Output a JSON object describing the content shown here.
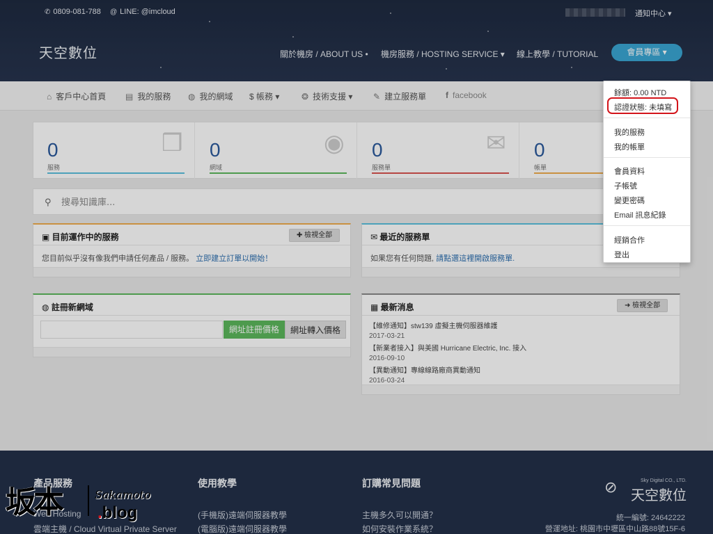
{
  "header": {
    "phone": "0809-081-788",
    "line": "LINE: @imcloud",
    "notify": "通知中心 ▾",
    "logo": "天空數位",
    "nav": [
      {
        "label": "關於機房 / ABOUT US •"
      },
      {
        "label": "機房服務 / HOSTING SERVICE ▾"
      },
      {
        "label": "線上教學 / TUTORIAL"
      }
    ],
    "member_button": "會員專區 ▾"
  },
  "subnav": [
    {
      "icon": "home-icon",
      "label": "客戶中心首頁"
    },
    {
      "icon": "list-icon",
      "label": "我的服務"
    },
    {
      "icon": "globe-icon",
      "label": "我的網域"
    },
    {
      "icon": "dollar-icon",
      "label": "$ 帳務 ▾"
    },
    {
      "icon": "lifebuoy-icon",
      "label": "技術支援 ▾"
    },
    {
      "icon": "edit-icon",
      "label": "建立服務單"
    },
    {
      "icon": "facebook-icon",
      "label": "facebook"
    }
  ],
  "stats": [
    {
      "value": "0",
      "label": "服務",
      "color": "#5bc0de"
    },
    {
      "value": "0",
      "label": "網域",
      "color": "#5cb85c"
    },
    {
      "value": "0",
      "label": "服務單",
      "color": "#d9534f"
    },
    {
      "value": "0",
      "label": "帳單",
      "color": "#f0ad4e"
    }
  ],
  "search": {
    "placeholder": "搜尋知識庫..."
  },
  "panels": {
    "services": {
      "title": "目前運作中的服務",
      "button": "✚ 檢視全部",
      "text": "您目前似乎沒有像我們申請任何產品 / 服務。",
      "link": "立即建立訂單以開始！"
    },
    "tickets": {
      "title": "最近的服務單",
      "text": "如果您有任何問題,",
      "link": "請點選這裡開啟服務單."
    },
    "domain": {
      "title": "註冊新網域",
      "register": "網址註冊價格",
      "transfer": "網址轉入價格"
    },
    "news": {
      "title": "最新消息",
      "button": "➜ 檢視全部",
      "items": [
        {
          "title": "【維修通知】stw139 虛擬主機伺服器維護",
          "date": "2017-03-21"
        },
        {
          "title": "【新業者接入】與美國 Hurricane Electric, Inc. 接入",
          "date": "2016-09-10"
        },
        {
          "title": "【異動通知】專線線路廠商異動通知",
          "date": "2016-03-24"
        }
      ]
    }
  },
  "dropdown": {
    "balance": "餘額: 0.00 NTD",
    "verify": "認證狀態: 未填寫",
    "items": [
      "我的服務",
      "我的帳單",
      "會員資料",
      "子帳號",
      "變更密碼",
      "Email 訊息紀錄",
      "經銷合作",
      "登出"
    ]
  },
  "footer": {
    "col1": {
      "title": "產品服務",
      "links": [
        "Web Hosting",
        "雲端主機 / Cloud Virtual Private Server"
      ]
    },
    "col2": {
      "title": "使用教學",
      "links": [
        "(手機版)遠端伺服器教學",
        "(電腦版)遠端伺服器教學"
      ]
    },
    "col3": {
      "title": "訂購常見問題",
      "links": [
        "主機多久可以開通？",
        "如何安裝作業系統？"
      ]
    },
    "brand_en": "Sky Digital CO., LTD.",
    "brand_cn": "天空數位",
    "tax_id": "統一編號: 24642222",
    "address": "營運地址: 桃園市中壢區中山路88號15F-6"
  },
  "watermark": {
    "cn": "坂本",
    "en": "Sakamoto",
    "blog": ".blog"
  }
}
